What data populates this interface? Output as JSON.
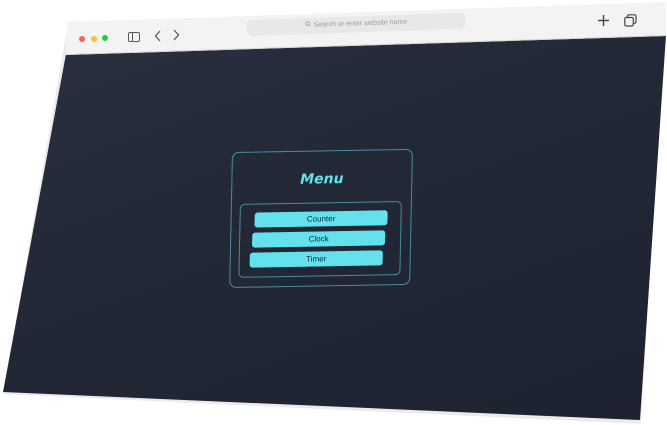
{
  "browser": {
    "address_bar": {
      "placeholder": "Search or enter website name"
    }
  },
  "menu": {
    "title": "Menu",
    "items": [
      {
        "label": "Counter"
      },
      {
        "label": "Clock"
      },
      {
        "label": "Timer"
      }
    ]
  },
  "colors": {
    "accent": "#63e2ee",
    "background": "#222836",
    "toolbar": "#f3f3f4"
  },
  "icons": {
    "search": "search-icon",
    "sidebar": "sidebar-toggle-icon",
    "back": "chevron-left-icon",
    "forward": "chevron-right-icon",
    "new_tab": "plus-icon",
    "tabs": "tabs-overview-icon"
  }
}
